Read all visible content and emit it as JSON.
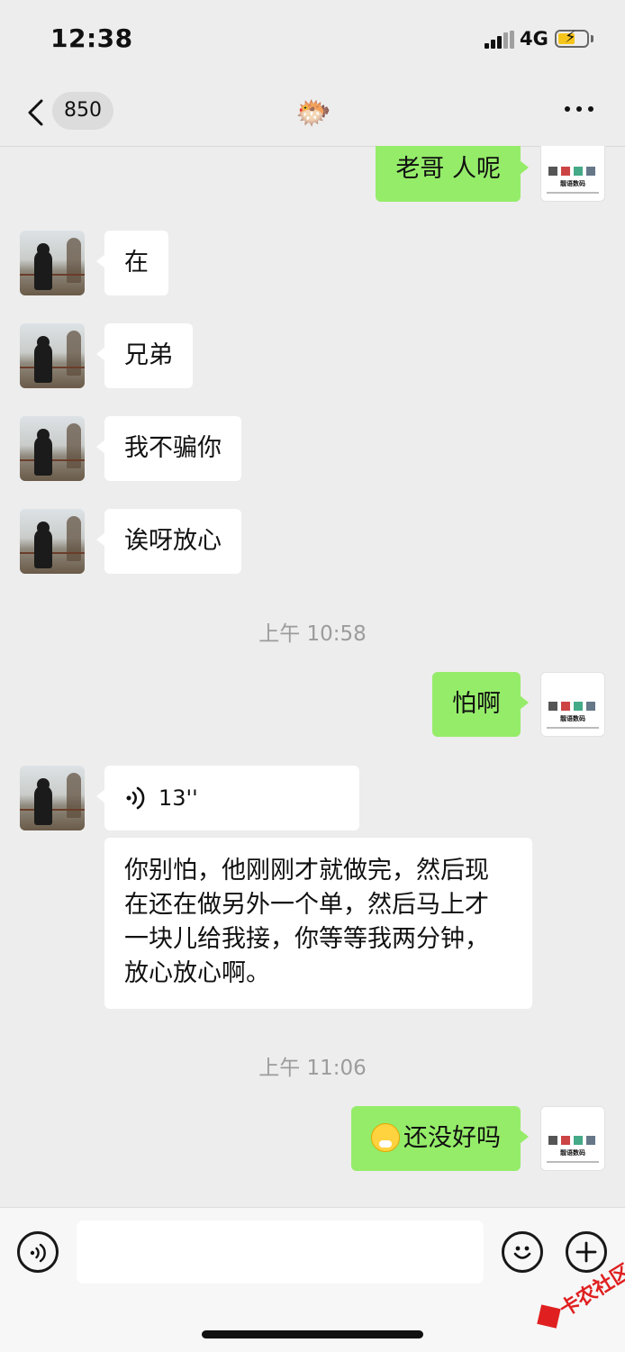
{
  "status_bar": {
    "time": "12:38",
    "network": "4G"
  },
  "nav": {
    "unread_count": "850",
    "title_emoji": "🐡"
  },
  "apple_avatar": {
    "logo": "",
    "caption": "靓语数码"
  },
  "messages": {
    "m1": "老哥 人呢",
    "m2": "在",
    "m3": "兄弟",
    "m4": "我不骗你",
    "m5": "诶呀放心",
    "ts1": "上午 10:58",
    "m6": "怕啊",
    "m7_voice_duration": "13''",
    "m8": "你别怕，他刚刚才就做完，然后现在还在做另外一个单，然后马上才一块儿给我接，你等等我两分钟，放心放心啊。",
    "ts2": "上午 11:06",
    "m9": "还没好吗"
  },
  "watermark": {
    "text": "卡农社区"
  },
  "colors": {
    "outgoing_bubble": "#95ec69",
    "incoming_bubble": "#ffffff",
    "chat_background": "#ededed",
    "battery_fill": "#f5c51b"
  }
}
